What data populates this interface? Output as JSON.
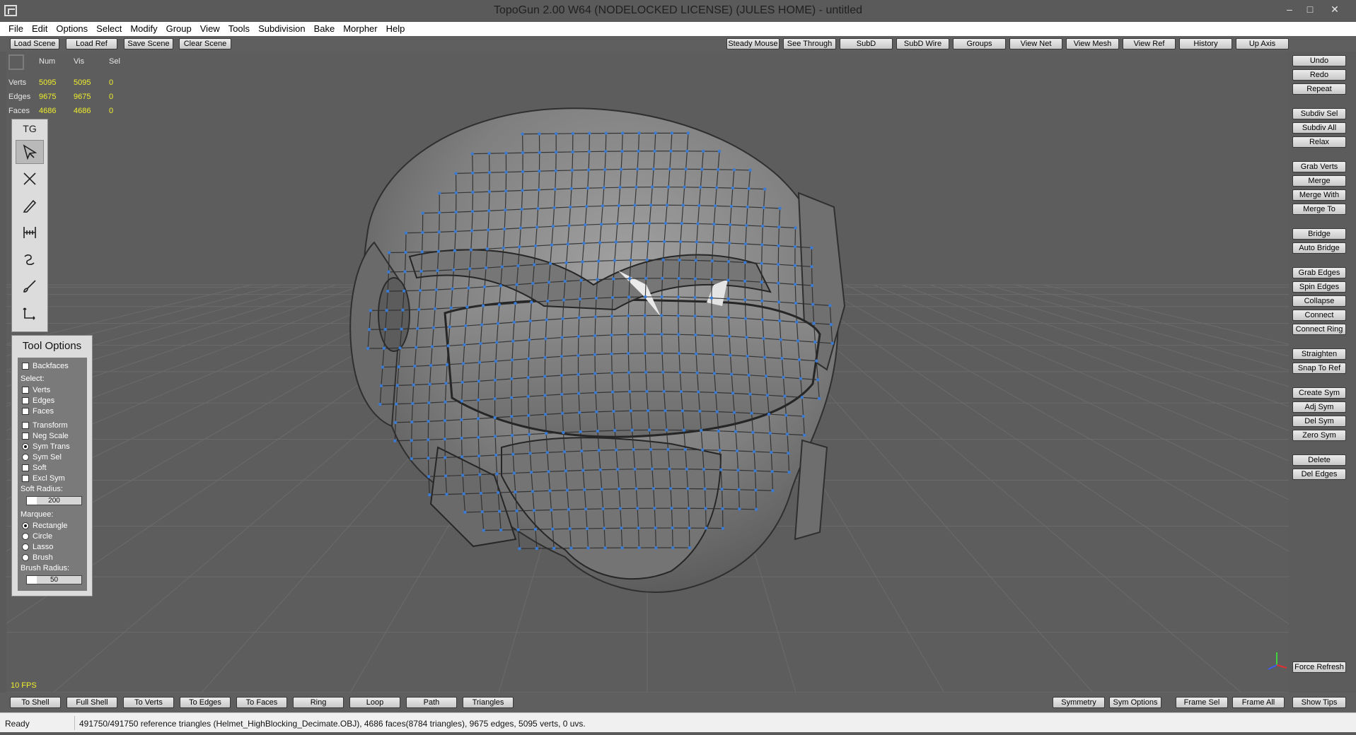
{
  "window": {
    "title": "TopoGun 2.00 W64  (NODELOCKED LICENSE) (JULES HOME) - untitled",
    "minimize": "–",
    "maximize": "□",
    "close": "✕"
  },
  "menu": [
    "File",
    "Edit",
    "Options",
    "Select",
    "Modify",
    "Group",
    "View",
    "Tools",
    "Subdivision",
    "Bake",
    "Morpher",
    "Help"
  ],
  "toolbar_left": [
    "Load Scene",
    "Load Ref",
    "Save Scene",
    "Clear Scene"
  ],
  "toolbar_right": [
    "Steady Mouse",
    "See Through",
    "SubD",
    "SubD Wire",
    "Groups",
    "View Net",
    "View Mesh",
    "View Ref",
    "History",
    "Up Axis"
  ],
  "stats": {
    "headers": [
      "Num",
      "Vis",
      "Sel"
    ],
    "rows": [
      {
        "label": "Verts",
        "num": "5095",
        "vis": "5095",
        "sel": "0"
      },
      {
        "label": "Edges",
        "num": "9675",
        "vis": "9675",
        "sel": "0"
      },
      {
        "label": "Faces",
        "num": "4686",
        "vis": "4686",
        "sel": "0"
      }
    ]
  },
  "palette": {
    "title": "TG",
    "tools": [
      "select-tool-icon",
      "cut-tool-icon",
      "draw-tool-icon",
      "bridge-tool-icon",
      "tubes-tool-icon",
      "brush-tool-icon",
      "extrude-tool-icon"
    ]
  },
  "tool_options": {
    "title": "Tool Options",
    "backfaces": "Backfaces",
    "select_label": "Select:",
    "select": [
      "Verts",
      "Edges",
      "Faces"
    ],
    "toggles": [
      {
        "label": "Transform",
        "type": "check",
        "on": false
      },
      {
        "label": "Neg Scale",
        "type": "check",
        "on": false
      },
      {
        "label": "Sym Trans",
        "type": "radio",
        "on": true
      },
      {
        "label": "Sym Sel",
        "type": "radio",
        "on": false
      },
      {
        "label": "Soft",
        "type": "check",
        "on": false
      },
      {
        "label": "Excl Sym",
        "type": "check",
        "on": false
      }
    ],
    "soft_radius_label": "Soft Radius:",
    "soft_radius": "200",
    "marquee_label": "Marquee:",
    "marquee": [
      "Rectangle",
      "Circle",
      "Lasso",
      "Brush"
    ],
    "marquee_selected": "Rectangle",
    "brush_radius_label": "Brush Radius:",
    "brush_radius": "50"
  },
  "fps": "10 FPS",
  "right_buttons": [
    [
      "Undo",
      "Redo",
      "Repeat"
    ],
    [
      "Subdiv Sel",
      "Subdiv All",
      "Relax"
    ],
    [
      "Grab Verts",
      "Merge",
      "Merge With",
      "Merge To"
    ],
    [
      "Bridge",
      "Auto Bridge"
    ],
    [
      "Grab Edges",
      "Spin Edges",
      "Collapse",
      "Connect",
      "Connect Ring"
    ],
    [
      "Straighten",
      "Snap To Ref"
    ],
    [
      "Create Sym",
      "Adj Sym",
      "Del Sym",
      "Zero Sym"
    ],
    [
      "Delete",
      "Del Edges"
    ]
  ],
  "force_refresh": "Force Refresh",
  "bottom_left": [
    "To Shell",
    "Full Shell",
    "To Verts",
    "To Edges",
    "To Faces",
    "Ring",
    "Loop",
    "Path",
    "Triangles"
  ],
  "bottom_right": [
    "Symmetry",
    "Sym Options",
    "Frame Sel",
    "Frame All"
  ],
  "show_tips": "Show Tips",
  "status": {
    "ready": "Ready",
    "message": "491750/491750 reference triangles (Helmet_HighBlocking_Decimate.OBJ), 4686 faces(8784 triangles), 9675 edges, 5095 verts, 0 uvs."
  },
  "colors": {
    "viewport_bg": "#5d5d5d",
    "stat_value": "#f0ee2c",
    "wire_vertex": "#3a7bd5",
    "mesh_shade": "#8c8c8c"
  }
}
